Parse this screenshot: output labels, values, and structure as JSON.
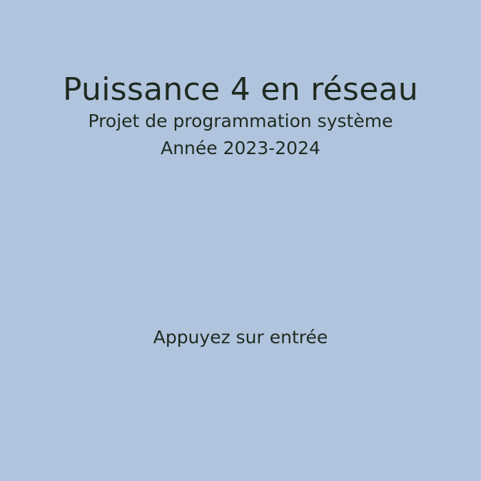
{
  "screen": {
    "title": "Puissance 4 en réseau",
    "subtitle": "Projet de programmation système",
    "year": "Année 2023-2024",
    "prompt": "Appuyez sur entrée"
  },
  "colors": {
    "background": "#b0c4de",
    "text": "#1f2a1f"
  }
}
